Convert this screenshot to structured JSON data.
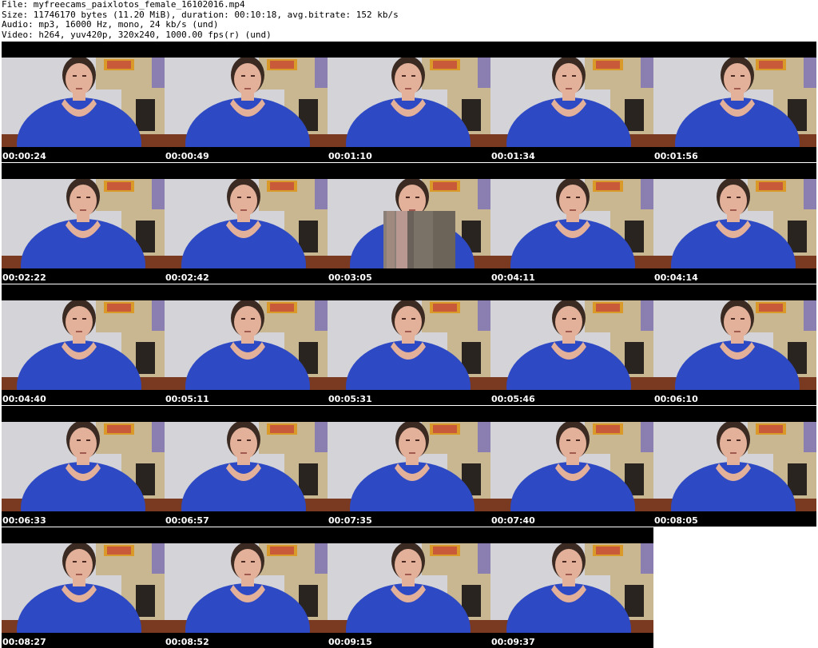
{
  "info": {
    "file": "File: myfreecams_paixlotos_female_16102016.mp4",
    "size": "Size: 11746170 bytes (11.20 MiB), duration: 00:10:18, avg.bitrate: 152 kb/s",
    "audio": "Audio: mp3, 16000 Hz, mono, 24 kb/s (und)",
    "video": "Video: h264, yuv420p, 320x240, 1000.00 fps(r) (und)"
  },
  "thumbnails": [
    {
      "time": "00:00:24",
      "glitch": false
    },
    {
      "time": "00:00:49",
      "glitch": false
    },
    {
      "time": "00:01:10",
      "glitch": false
    },
    {
      "time": "00:01:34",
      "glitch": false
    },
    {
      "time": "00:01:56",
      "glitch": false
    },
    {
      "time": "00:02:22",
      "glitch": false
    },
    {
      "time": "00:02:42",
      "glitch": false
    },
    {
      "time": "00:03:05",
      "glitch": true
    },
    {
      "time": "00:04:11",
      "glitch": false
    },
    {
      "time": "00:04:14",
      "glitch": false
    },
    {
      "time": "00:04:40",
      "glitch": false
    },
    {
      "time": "00:05:11",
      "glitch": false
    },
    {
      "time": "00:05:31",
      "glitch": false
    },
    {
      "time": "00:05:46",
      "glitch": false
    },
    {
      "time": "00:06:10",
      "glitch": false
    },
    {
      "time": "00:06:33",
      "glitch": false
    },
    {
      "time": "00:06:57",
      "glitch": false
    },
    {
      "time": "00:07:35",
      "glitch": false
    },
    {
      "time": "00:07:40",
      "glitch": false
    },
    {
      "time": "00:08:05",
      "glitch": false
    },
    {
      "time": "00:08:27",
      "glitch": false
    },
    {
      "time": "00:08:52",
      "glitch": false
    },
    {
      "time": "00:09:15",
      "glitch": false
    },
    {
      "time": "00:09:37",
      "glitch": false
    }
  ],
  "colors": {
    "wall": "#d4d4d8",
    "lavender": "#8a7fb0",
    "shirt": "#2e49c4",
    "skin": "#e3b09a",
    "hair": "#3a2a22",
    "frame": "#d99a2a",
    "brick": "#c8b790"
  }
}
